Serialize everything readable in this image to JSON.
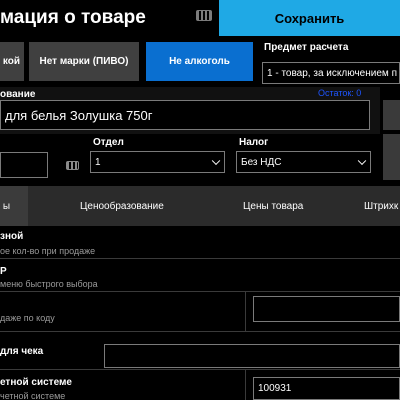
{
  "header": {
    "title": "мация о товаре",
    "keyboard_icon": "keyboard-icon",
    "save_label": "Сохранить",
    "accent_color": "#1fa9e5"
  },
  "marking": {
    "items": [
      {
        "label": "кой",
        "active": false
      },
      {
        "label": "Нет марки (ПИВО)",
        "active": false
      },
      {
        "label": "Не алкоголь",
        "active": true
      }
    ]
  },
  "payment_subject": {
    "label": "Предмет расчета",
    "value": "1 - товар, за исключением п"
  },
  "name": {
    "label": "ование",
    "remain": "Остаток: 0",
    "value": "для белья Золушка 750г"
  },
  "department": {
    "label": "Отдел",
    "value": "1"
  },
  "tax": {
    "label": "Налог",
    "value": "Без НДС"
  },
  "tabs": [
    {
      "label": "ы",
      "active": true
    },
    {
      "label": "Ценообразование",
      "active": false
    },
    {
      "label": "Цены товара",
      "active": false
    },
    {
      "label": "Штрихк",
      "active": false
    }
  ],
  "rows": {
    "weight": {
      "title": "зной",
      "subtitle": "ое кол-во при продаже"
    },
    "quick": {
      "title": "Р",
      "subtitle": "меню быстрого выбора"
    },
    "by_code": {
      "subtitle": "даже по коду"
    },
    "receipt": {
      "title": "для чека"
    },
    "accounting": {
      "title": "етной системе",
      "subtitle": "четной системе",
      "value": "100931"
    }
  }
}
